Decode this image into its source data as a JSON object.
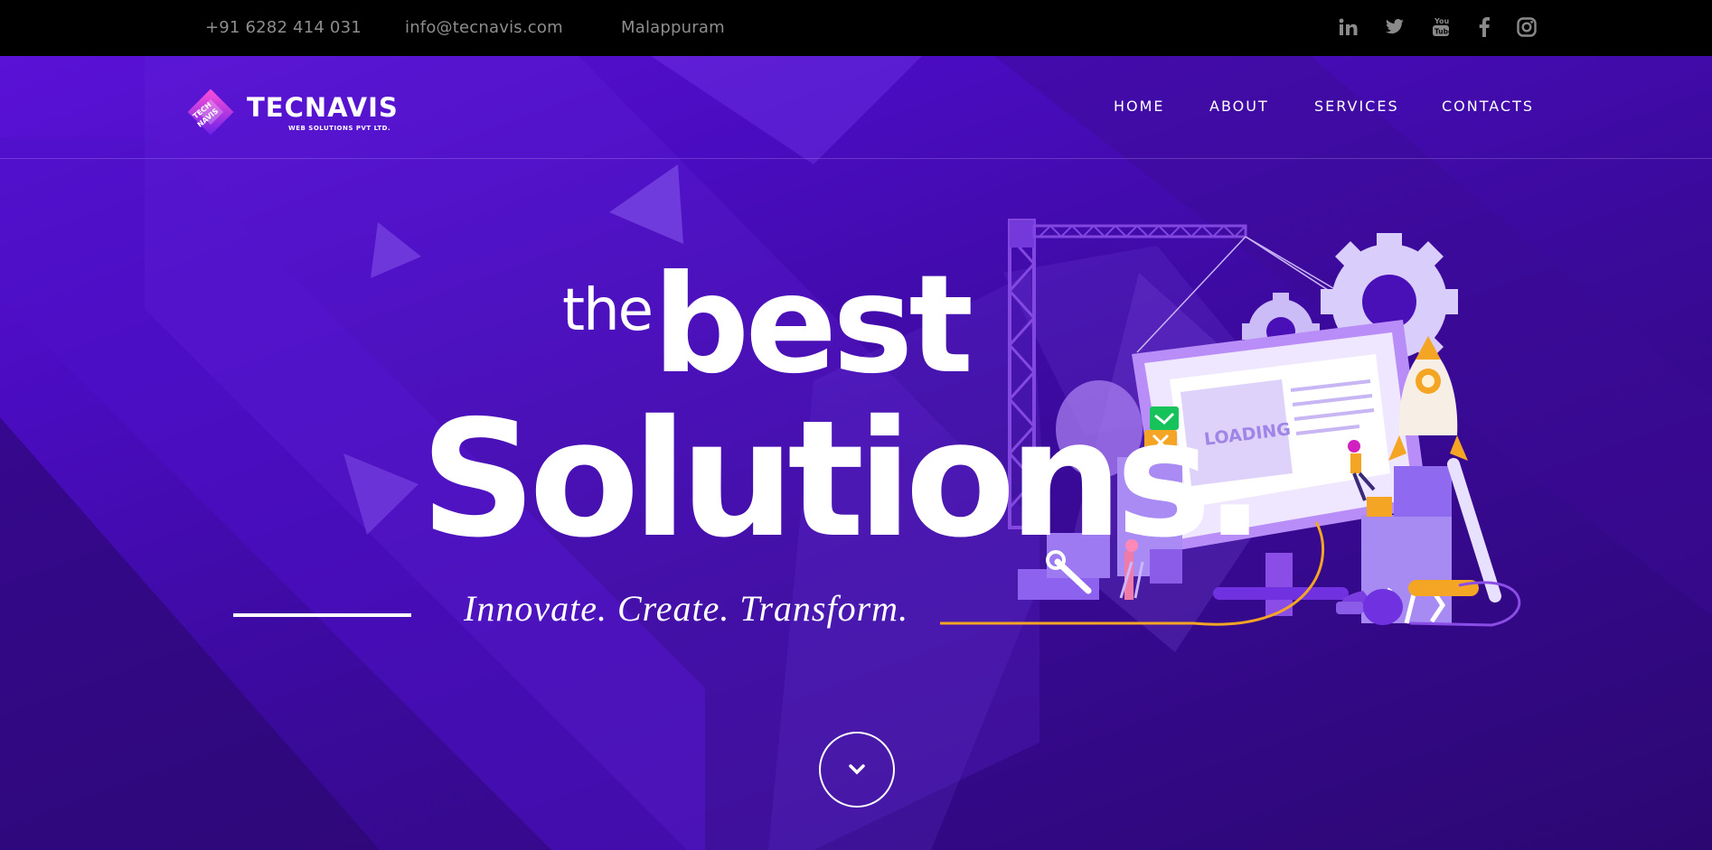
{
  "topbar": {
    "phone": "+91 6282 414 031",
    "email": "info@tecnavis.com",
    "location": "Malappuram",
    "social": [
      "linkedin-icon",
      "twitter-icon",
      "youtube-icon",
      "facebook-icon",
      "instagram-icon"
    ]
  },
  "logo": {
    "name": "TECNAVIS",
    "subtitle": "WEB SOLUTIONS PVT LTD.",
    "mark_text": "TECH NAVIS"
  },
  "nav": {
    "items": [
      "HOME",
      "ABOUT",
      "SERVICES",
      "CONTACTS"
    ]
  },
  "hero": {
    "headline_small": "the",
    "headline_large": "best",
    "headline_main": "Solutions.",
    "tagline": "Innovate. Create. Transform.",
    "illustration_label": "LOADING"
  },
  "colors": {
    "background_top": "#5a12d6",
    "background_bottom": "#2c0772",
    "topbar": "#000000",
    "accent_orange": "#f5a524",
    "accent_green": "#16c25a"
  }
}
